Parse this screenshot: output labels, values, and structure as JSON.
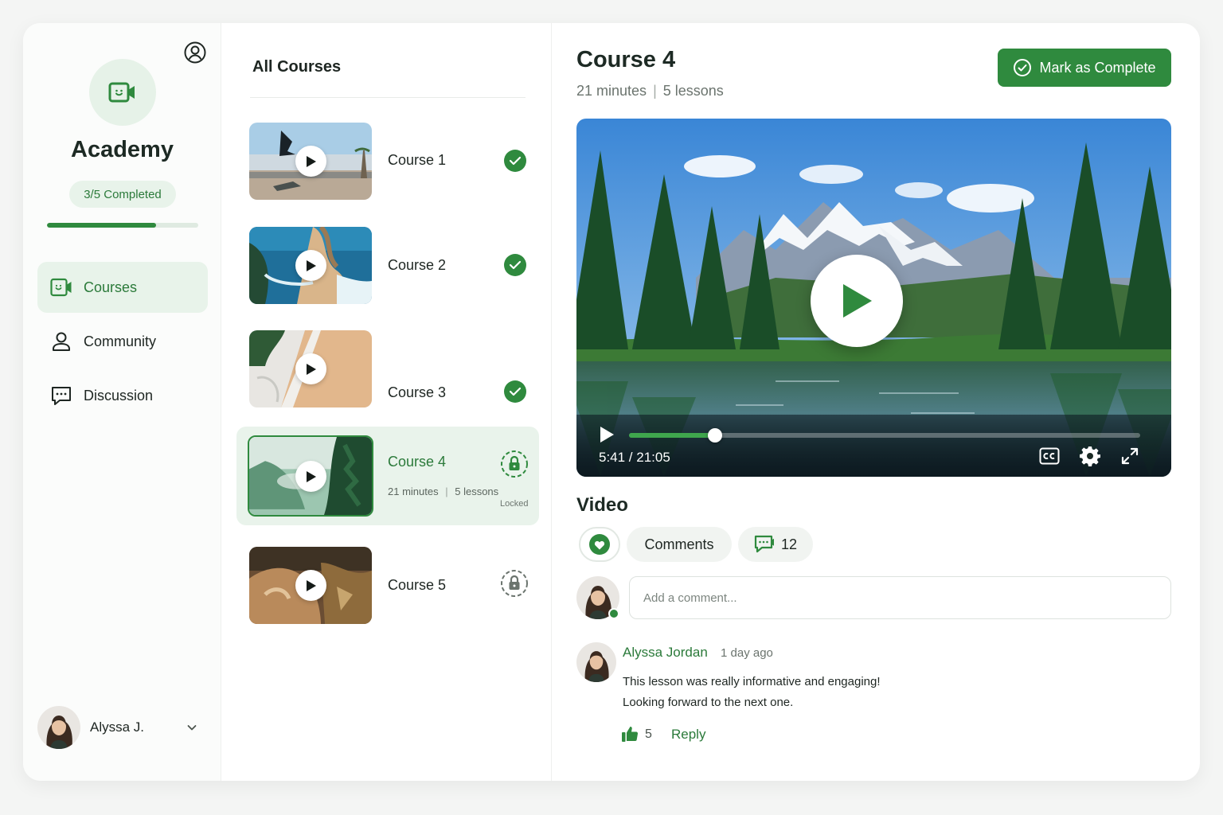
{
  "brand": {
    "name": "Academy",
    "icon": "video-camera-icon",
    "accent": "#2f8a3e"
  },
  "progress": {
    "label": "3/5 Completed",
    "completed": 3,
    "total": 5,
    "fraction": 0.72
  },
  "nav": {
    "items": [
      {
        "label": "Courses",
        "icon": "video-camera-icon",
        "active": true
      },
      {
        "label": "Community",
        "icon": "user-icon",
        "active": false
      },
      {
        "label": "Discussion",
        "icon": "chat-bubble-icon",
        "active": false
      }
    ]
  },
  "user": {
    "name": "Alyssa J."
  },
  "course_list": {
    "title": "All Courses",
    "courses": [
      {
        "name": "Course 1",
        "status": "completed"
      },
      {
        "name": "Course 2",
        "status": "completed"
      },
      {
        "name": "Course 3",
        "status": "completed"
      },
      {
        "name": "Course 4",
        "status": "locked",
        "minutes": "21 minutes",
        "lessons": "5 lessons",
        "status_label": "Locked",
        "active": true
      },
      {
        "name": "Course 5",
        "status": "locked"
      }
    ]
  },
  "main": {
    "title": "Course 4",
    "minutes": "21 minutes",
    "separator": "|",
    "lessons": "5 lessons",
    "complete_button": "Mark as Complete"
  },
  "video": {
    "time": "5:41 / 21:05",
    "progress": 0.168
  },
  "social": {
    "section_label": "Video",
    "comments_label": "Comments",
    "comment_count": "12",
    "input_placeholder": "Add a comment..."
  },
  "comment": {
    "author": "Alyssa Jordan",
    "time": "1 day ago",
    "line1": "This lesson was really informative and engaging!",
    "line2": "Looking forward to the next one.",
    "likes": "5",
    "reply_label": "Reply"
  }
}
